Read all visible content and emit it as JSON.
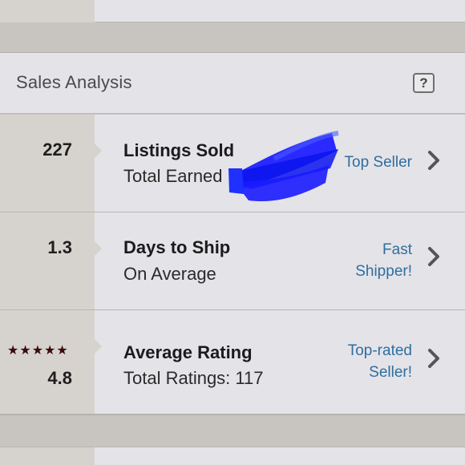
{
  "header": {
    "title": "Sales Analysis",
    "help_label": "?"
  },
  "rows": [
    {
      "stat": "227",
      "label": "Listings Sold",
      "sublabel": "Total Earned",
      "badge_lines": [
        "Top Seller"
      ]
    },
    {
      "stat": "1.3",
      "label": "Days to Ship",
      "sublabel": "On Average",
      "badge_lines": [
        "Fast",
        "Shipper!"
      ]
    },
    {
      "stat": "4.8",
      "stars": "★★★★★",
      "label": "Average Rating",
      "sublabel": "Total Ratings: 117",
      "badge_lines": [
        "Top-rated",
        "Seller!"
      ]
    }
  ],
  "icons": {
    "help": "question-icon",
    "chevron": "chevron-right-icon",
    "star": "star-icon",
    "redaction": "blue-scribble"
  },
  "colors": {
    "badge": "#2f6e9e",
    "redaction": "#1a1aff",
    "stars": "#3a0a0a"
  }
}
